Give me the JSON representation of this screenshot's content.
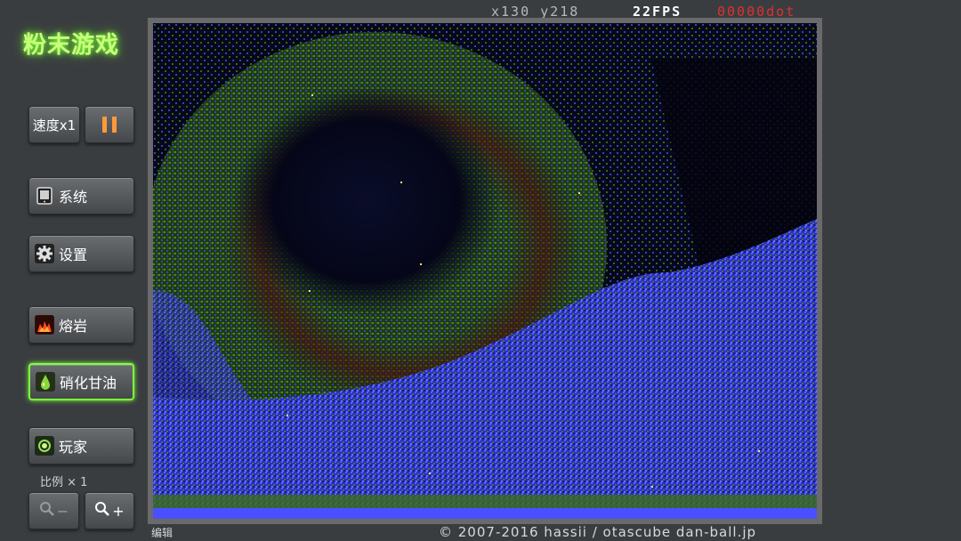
{
  "app": {
    "title": "粉末游戏"
  },
  "controls": {
    "speed_label": "速度x1",
    "system_label": "系统",
    "settings_label": "设置",
    "scale_label": "比例 × 1",
    "zoom_out_label": "−",
    "zoom_in_label": "+"
  },
  "elements": [
    {
      "label": "熔岩",
      "icon": "lava-icon",
      "selected": false
    },
    {
      "label": "硝化甘油",
      "icon": "nitro-drop-icon",
      "selected": true
    },
    {
      "label": "玩家",
      "icon": "player-icon",
      "selected": false
    }
  ],
  "status": {
    "coords": "x130 y218",
    "fps": "22FPS",
    "dots": "00000dot"
  },
  "footer": {
    "edit_label": "编辑",
    "copyright": "© 2007-2016 hassii / otascube dan-ball.jp"
  },
  "colors": {
    "accent_green": "#7dff3a",
    "pause_orange": "#ff9a3a",
    "dot_red": "#e03030",
    "particle_blue": "#4a50ff",
    "particle_green": "#3f7a1c"
  }
}
